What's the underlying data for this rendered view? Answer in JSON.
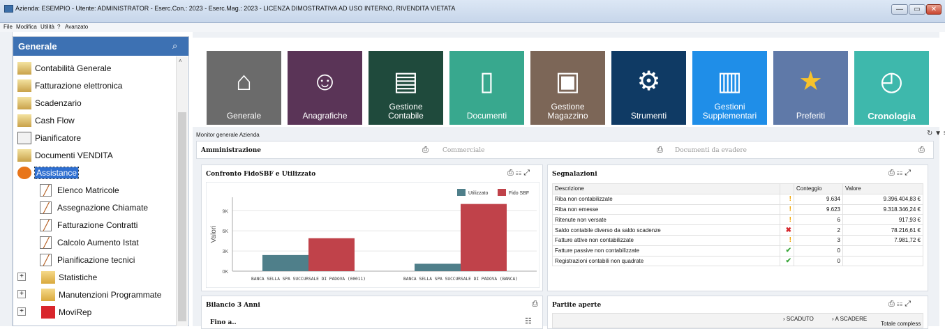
{
  "window": {
    "title": "Azienda: ESEMPIO - Utente: ADMINISTRATOR - Eserc.Con.: 2023 - Eserc.Mag.: 2023 - LICENZA DIMOSTRATIVA AD USO INTERNO, RIVENDITA VIETATA"
  },
  "menu": [
    "File",
    "Modifica",
    "Utilità",
    "?",
    "Avanzato"
  ],
  "sidebar": {
    "title": "Generale",
    "items": [
      {
        "label": "Contabilità Generale",
        "icon": "accounting-icon"
      },
      {
        "label": "Fatturazione elettronica",
        "icon": "e-invoice-icon"
      },
      {
        "label": "Scadenzario",
        "icon": "deadline-icon"
      },
      {
        "label": "Cash Flow",
        "icon": "cash-flow-icon"
      },
      {
        "label": "Pianificatore",
        "icon": "planner-icon"
      },
      {
        "label": "Documenti VENDITA",
        "icon": "sales-documents-icon"
      },
      {
        "label": "Assistance",
        "icon": "assistance-icon",
        "selected": true
      },
      {
        "label": "Elenco Matricole",
        "icon": "document-icon",
        "child": true
      },
      {
        "label": "Assegnazione Chiamate",
        "icon": "document-icon",
        "child": true
      },
      {
        "label": "Fatturazione Contratti",
        "icon": "document-icon",
        "child": true
      },
      {
        "label": "Calcolo Aumento Istat",
        "icon": "document-icon",
        "child": true
      },
      {
        "label": "Pianificazione tecnici",
        "icon": "document-icon",
        "child": true
      },
      {
        "label": "Statistiche",
        "icon": "folder-icon",
        "expandable": true
      },
      {
        "label": "Manutenzioni Programmate",
        "icon": "folder-icon",
        "expandable": true
      },
      {
        "label": "MoviRep",
        "icon": "movirep-icon",
        "expandable": true
      }
    ]
  },
  "tiles": [
    {
      "label": "Generale",
      "color": "#6b6b6b",
      "icon": "home-icon"
    },
    {
      "label": "Anagrafiche",
      "color": "#5a3457",
      "icon": "users-icon"
    },
    {
      "label": "Gestione\nContabile",
      "color": "#1f4a3c",
      "icon": "ledger-icon"
    },
    {
      "label": "Documenti",
      "color": "#38a88e",
      "icon": "folder-documents-icon"
    },
    {
      "label": "Gestione\nMagazzino",
      "color": "#7c6657",
      "icon": "warehouse-box-icon"
    },
    {
      "label": "Strumenti",
      "color": "#0f3a64",
      "icon": "toolbox-icon"
    },
    {
      "label": "Gestioni\nSupplementari",
      "color": "#1f8ee8",
      "icon": "books-icon"
    },
    {
      "label": "Preferiti",
      "color": "#5f79a8",
      "icon": "star-icon"
    },
    {
      "label": "Cronologia",
      "color": "#3eb8ac",
      "icon": "clock-icon"
    }
  ],
  "monitor": {
    "label": "Monitor generale Azienda",
    "tabs": [
      "Amministrazione",
      "Commerciale",
      "Documenti da evadere"
    ]
  },
  "chart_panel": {
    "title": "Confronto FidoSBF e Utilizzato"
  },
  "chart_data": {
    "type": "bar",
    "categories": [
      "BANCA SELLA SPA SUCCURSALE DI PADOVA (00011)",
      "BANCA SELLA SPA SUCCURSALE DI PADOVA (BANCA)"
    ],
    "series": [
      {
        "name": "Utilizzato",
        "values": [
          2400,
          1100
        ],
        "color": "#4f7f8a"
      },
      {
        "name": "Fido SBF",
        "values": [
          4900,
          10000
        ],
        "color": "#c0424a"
      }
    ],
    "ylabel": "Valori",
    "yticks": [
      "0K",
      "3K",
      "6K",
      "9K"
    ],
    "ylim": [
      0,
      11000
    ],
    "legend": "top-right"
  },
  "segnalazioni": {
    "title": "Segnalazioni",
    "columns": [
      "Descrizione",
      "Conteggio",
      "Valore"
    ],
    "rows": [
      {
        "desc": "Riba non contabilizzate",
        "status": "!",
        "count": "9.634",
        "value": "9.396.404,83 €"
      },
      {
        "desc": "Riba non emesse",
        "status": "!",
        "count": "9.623",
        "value": "9.318.346,24 €"
      },
      {
        "desc": "Ritenute non versate",
        "status": "!",
        "count": "6",
        "value": "917,93 €"
      },
      {
        "desc": "Saldo contabile diverso da saldo scadenze",
        "status": "✖",
        "count": "2",
        "value": "78.216,61 €"
      },
      {
        "desc": "Fatture attive non contabilizzate",
        "status": "!",
        "count": "3",
        "value": "7.981,72 €"
      },
      {
        "desc": "Fatture passive non contabilizzate",
        "status": "✔",
        "count": "0",
        "value": ""
      },
      {
        "desc": "Registrazioni contabili non quadrate",
        "status": "✔",
        "count": "0",
        "value": ""
      }
    ]
  },
  "bilancio": {
    "title": "Bilancio 3 Anni",
    "field": "Fino a.."
  },
  "partite": {
    "title": "Partite aperte",
    "columns": [
      "› SCADUTO",
      "› A SCADERE",
      "Totale compless"
    ]
  },
  "status_colors": {
    "warning": "#f0a400",
    "error": "#d6262c",
    "ok": "#3aa63a"
  }
}
